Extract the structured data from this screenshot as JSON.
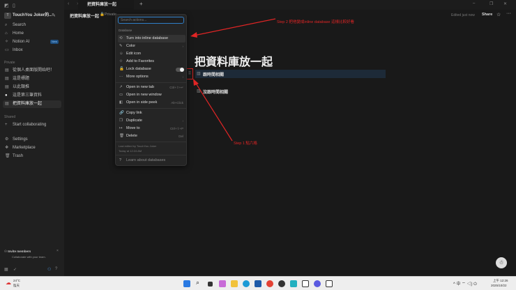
{
  "window": {
    "tab_title": "把資料庫放一起",
    "breadcrumb": "把資料庫放一起",
    "privacy": "Private",
    "edited": "Edited just now",
    "share": "Share"
  },
  "sidebar": {
    "workspace": "TouchYou Joker的...",
    "nav": [
      {
        "icon": "search-icon",
        "label": "Search"
      },
      {
        "icon": "home-icon",
        "label": "Home"
      },
      {
        "icon": "notion-ai-icon",
        "label": "Notion AI",
        "badge": "New"
      },
      {
        "icon": "inbox-icon",
        "label": "Inbox"
      }
    ],
    "private_label": "Private",
    "pages": [
      "從個人桌面版開始吧！",
      "這是標題",
      "以此類推",
      "這是第三筆資料",
      "把資料庫放一起"
    ],
    "shared_label": "Shared",
    "start_collab": "Start collaborating",
    "bottom": [
      "Settings",
      "Marketplace",
      "Trash"
    ],
    "invite_title": "Invite members",
    "invite_sub": "Collaborate with your team."
  },
  "menu": {
    "search_placeholder": "Search actions...",
    "section": "Database",
    "items": [
      {
        "label": "Turn into inline database"
      },
      {
        "label": "Color"
      },
      {
        "label": "Edit icon"
      },
      {
        "label": "Add to Favorites"
      },
      {
        "label": "Lock database"
      },
      {
        "label": "More options"
      },
      {
        "label": "Open in new tab",
        "shortcut": "Ctrl+⇧+↵"
      },
      {
        "label": "Open in new window"
      },
      {
        "label": "Open in side peek",
        "shortcut": "Alt+Click"
      },
      {
        "label": "Copy link"
      },
      {
        "label": "Duplicate"
      },
      {
        "label": "Move to",
        "shortcut": "Ctrl+⇧+P"
      },
      {
        "label": "Delete",
        "shortcut": "Del"
      }
    ],
    "footer1": "Last edited by TouchYou Joker",
    "footer2": "Today at 12:24 AM",
    "learn": "Learn about databases"
  },
  "page": {
    "title": "把資料庫放一起",
    "db1": "跟時間相關",
    "db2": "沒跟時間相關"
  },
  "annotations": {
    "step2": "Step 2 把他變成inline database 這樣比較好看",
    "step1": "Step 1 點六格"
  },
  "taskbar": {
    "temp": "24°C",
    "weather": "陰天",
    "time": "上午 12:26",
    "date": "2025/10/22"
  }
}
